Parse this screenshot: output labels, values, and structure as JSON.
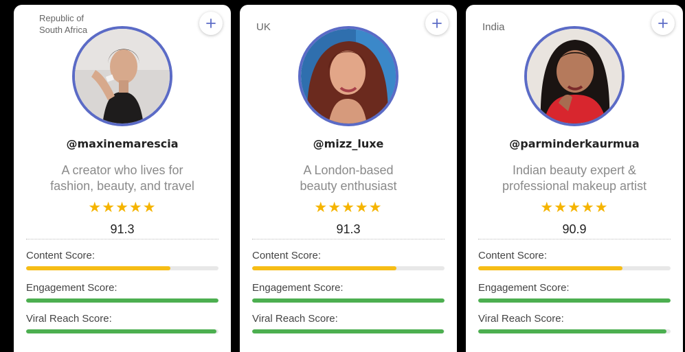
{
  "colors": {
    "accent_border": "#5b6bc6",
    "star": "#f5b400",
    "content_bar": "#f6bd16",
    "green_bar": "#4caf50",
    "track": "#e8e8e8"
  },
  "icons": {
    "add": "plus-icon",
    "star": "star-icon"
  },
  "cards": [
    {
      "country": "Republic of South Africa",
      "handle": "@maxinemarescia",
      "bio_line1": "A creator who lives for",
      "bio_line2": "fashion, beauty, and travel",
      "stars": "★★★★★",
      "rating": 5,
      "score": "91.3",
      "content_label": "Content Score:",
      "content_value": 0.75,
      "engagement_label": "Engagement Score:",
      "engagement_value": 1.0,
      "viral_label": "Viral Reach Score:",
      "viral_value": 0.99
    },
    {
      "country": "UK",
      "handle": "@mizz_luxe",
      "bio_line1": "A London-based",
      "bio_line2": "beauty enthusiast",
      "stars": "★★★★★",
      "rating": 5,
      "score": "91.3",
      "content_label": "Content Score:",
      "content_value": 0.75,
      "engagement_label": "Engagement Score:",
      "engagement_value": 1.0,
      "viral_label": "Viral Reach Score:",
      "viral_value": 0.995
    },
    {
      "country": "India",
      "handle": "@parminderkaurmua",
      "bio_line1": "Indian beauty expert &",
      "bio_line2": "professional makeup artist",
      "stars": "★★★★★",
      "rating": 5,
      "score": "90.9",
      "content_label": "Content Score:",
      "content_value": 0.75,
      "engagement_label": "Engagement Score:",
      "engagement_value": 1.0,
      "viral_label": "Viral Reach Score:",
      "viral_value": 0.98
    }
  ]
}
